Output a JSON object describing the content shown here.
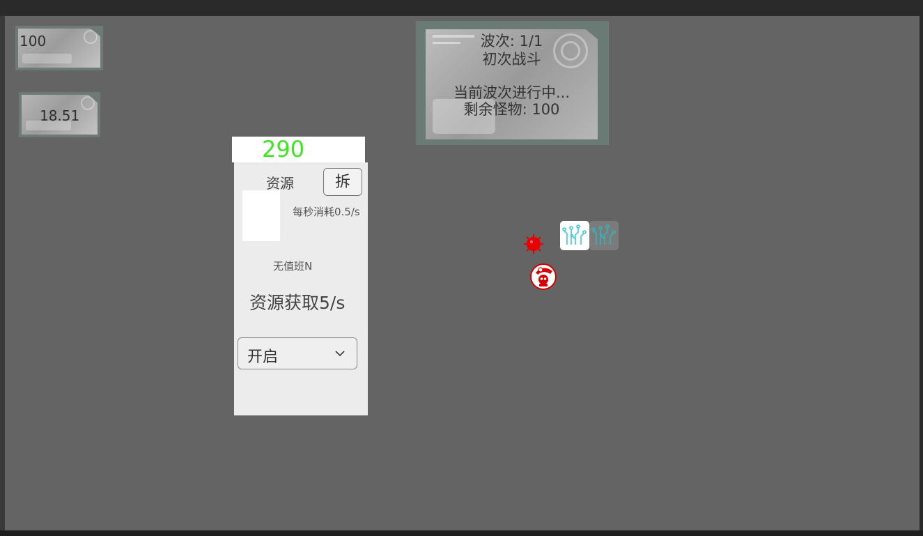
{
  "hud": {
    "stat_top": "100",
    "stat_bottom": "18.51"
  },
  "wave": {
    "wave_label": "波次: 1/1",
    "wave_name": "初次战斗",
    "status": "当前波次进行中...",
    "remaining": "剩余怪物: 100"
  },
  "building": {
    "cost": "290",
    "title": "资源",
    "demolish_label": "拆",
    "consume": "每秒消耗0.5/s",
    "duty": "无值班N",
    "gain": "资源获取5/s",
    "mode_selected": "开启"
  },
  "colors": {
    "cost_text": "#3de623",
    "enemy": "#e60000",
    "chip_line": "#3ec9d6"
  },
  "icons": {
    "chip": "circuit-chip-icon",
    "enemy": "virus-icon",
    "hero": "hero-avatar-icon"
  }
}
